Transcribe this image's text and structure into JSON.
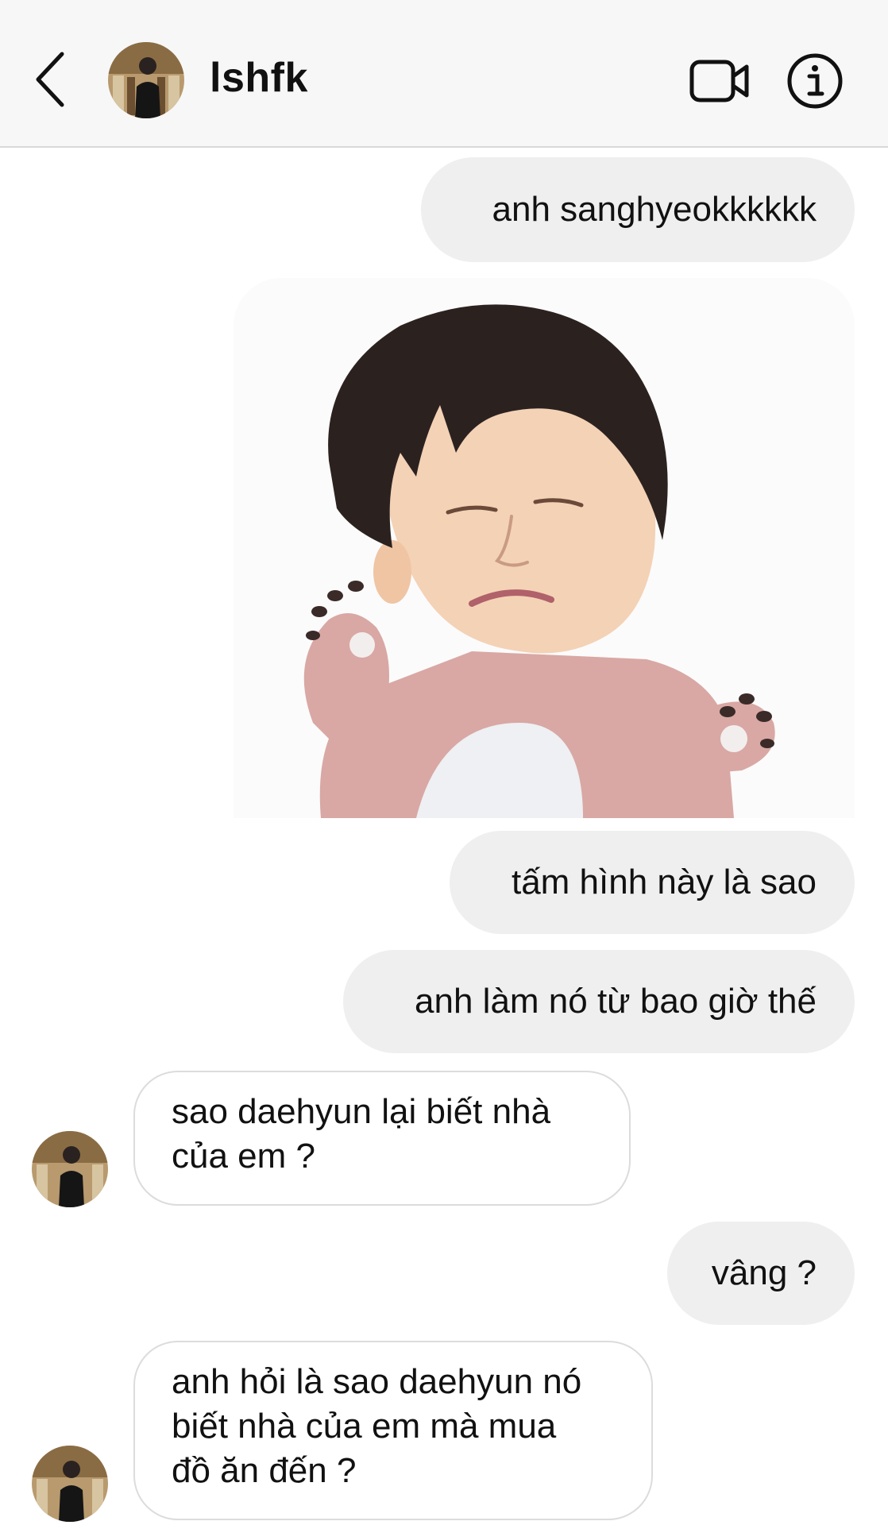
{
  "header": {
    "username": "lshfk"
  },
  "messages": [
    {
      "side": "out",
      "text": "anh sanghyeokkkkkk"
    },
    {
      "side": "out",
      "type": "sticker"
    },
    {
      "side": "out",
      "text": "tấm hình này là sao"
    },
    {
      "side": "out",
      "text": "anh làm nó từ bao giờ thế"
    },
    {
      "side": "in",
      "lines": [
        "sao daehyun lại biết nhà",
        "của em ?"
      ]
    },
    {
      "side": "out",
      "text": "vâng ?"
    },
    {
      "side": "in",
      "lines": [
        "anh hỏi là sao daehyun nó",
        "biết nhà của em mà mua",
        "đồ ăn đến ?"
      ]
    }
  ],
  "icons": {
    "back": "chevron-left-icon",
    "video": "video-camera-icon",
    "info": "info-icon"
  },
  "colors": {
    "outgoing_bubble": "#efefef",
    "incoming_border": "#dcdcdc",
    "header_bg": "#f7f7f7"
  }
}
